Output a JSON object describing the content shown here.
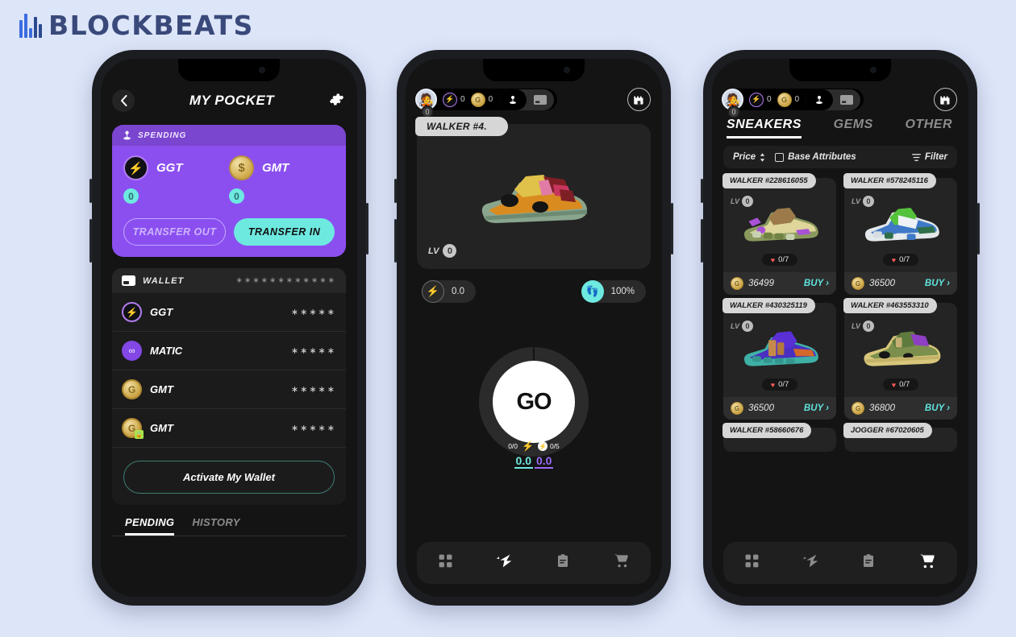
{
  "brand": {
    "name": "BLOCKBEATS"
  },
  "theme": {
    "page_bg": "#dde5f9",
    "screen_bg": "#141414",
    "accent_purple": "#8b4ff0",
    "accent_teal": "#6ee9e0",
    "gold": "#caa446"
  },
  "phone1": {
    "header": {
      "back_icon": "chevron-left-icon",
      "title": "MY POCKET",
      "settings_icon": "gear-icon"
    },
    "spending": {
      "label": "SPENDING",
      "header_icon": "joystick-icon",
      "tokens": [
        {
          "name": "GGT",
          "icon": "ggt-coin-icon",
          "value": "0"
        },
        {
          "name": "GMT",
          "icon": "gmt-coin-icon",
          "value": "0"
        }
      ],
      "transfer_out": "TRANSFER OUT",
      "transfer_in": "TRANSFER IN"
    },
    "wallet": {
      "label": "WALLET",
      "icon": "card-icon",
      "address_mask": "∗∗∗∗∗∗∗∗∗∗∗∗",
      "rows": [
        {
          "name": "GGT",
          "icon": "ggt-coin-icon",
          "amount": "∗∗∗∗∗"
        },
        {
          "name": "MATIC",
          "icon": "matic-coin-icon",
          "amount": "∗∗∗∗∗"
        },
        {
          "name": "GMT",
          "icon": "gmt-coin-icon",
          "amount": "∗∗∗∗∗"
        },
        {
          "name": "GMT",
          "icon": "gmt-locked-coin-icon",
          "amount": "∗∗∗∗∗"
        }
      ],
      "activate_label": "Activate My Wallet"
    },
    "tabs": [
      {
        "label": "PENDING",
        "active": true
      },
      {
        "label": "HISTORY",
        "active": false
      }
    ]
  },
  "phone2": {
    "header": {
      "avatar_icon": "avatar-icon",
      "avatar_badge": "0",
      "currencies": [
        {
          "icon": "ggt-coin-icon",
          "value": "0"
        },
        {
          "icon": "gmt-coin-icon",
          "value": "0"
        }
      ],
      "segments": [
        {
          "icon": "joystick-icon",
          "active": true
        },
        {
          "icon": "card-icon",
          "active": false
        }
      ],
      "right_icon": "castle-icon"
    },
    "sneaker": {
      "name": "WALKER #4.",
      "level_label": "LV",
      "level_value": "0"
    },
    "stats": [
      {
        "icon": "energy-bolt-icon",
        "value": "0.0"
      },
      {
        "icon": "footprint-icon",
        "value": "100%"
      }
    ],
    "go": {
      "label": "GO",
      "left_fraction": "0/0",
      "right_fraction": "0/5",
      "left_value": "0.0",
      "right_value": "0.0",
      "bolt_icon": "bolt-icon"
    },
    "nav": [
      {
        "icon": "grid-icon",
        "active": false
      },
      {
        "icon": "bolt-icon",
        "active": true
      },
      {
        "icon": "clipboard-icon",
        "active": false
      },
      {
        "icon": "cart-icon",
        "active": false
      }
    ]
  },
  "phone3": {
    "header": {
      "avatar_icon": "avatar-icon",
      "avatar_badge": "0",
      "currencies": [
        {
          "icon": "ggt-coin-icon",
          "value": "0"
        },
        {
          "icon": "gmt-coin-icon",
          "value": "0"
        }
      ],
      "segments": [
        {
          "icon": "joystick-icon",
          "active": true
        },
        {
          "icon": "card-icon",
          "active": false
        }
      ],
      "right_icon": "castle-icon"
    },
    "tabs": [
      {
        "label": "SNEAKERS",
        "active": true
      },
      {
        "label": "GEMS",
        "active": false
      },
      {
        "label": "OTHER",
        "active": false
      }
    ],
    "filters": {
      "sort_label": "Price",
      "sort_icon": "sort-updown-icon",
      "checkbox_label": "Base Attributes",
      "checkbox_checked": false,
      "filter_label": "Filter",
      "filter_icon": "filter-icon"
    },
    "cards": [
      {
        "type": "WALKER",
        "id": "#228616055",
        "level_label": "LV",
        "level": "0",
        "hp": "0/7",
        "price": "36499",
        "buy_label": "BUY",
        "palette": [
          "#e2d9a0",
          "#9aa55e",
          "#8a6a40",
          "#b05fd0"
        ]
      },
      {
        "type": "WALKER",
        "id": "#578245116",
        "level_label": "LV",
        "level": "0",
        "hp": "0/7",
        "price": "36500",
        "buy_label": "BUY",
        "palette": [
          "#4a86d6",
          "#57c23c",
          "#e6e9ea",
          "#2e6f4a"
        ]
      },
      {
        "type": "WALKER",
        "id": "#430325119",
        "level_label": "LV",
        "level": "0",
        "hp": "0/7",
        "price": "36500",
        "buy_label": "BUY",
        "palette": [
          "#5b2fd6",
          "#c58a4a",
          "#46b2a8",
          "#d4682a"
        ]
      },
      {
        "type": "WALKER",
        "id": "#463553310",
        "level_label": "LV",
        "level": "0",
        "hp": "0/7",
        "price": "36800",
        "buy_label": "BUY",
        "palette": [
          "#7c8f4c",
          "#8e3fc4",
          "#d8c77a",
          "#5f7a3d"
        ]
      }
    ],
    "cut_cards": [
      {
        "label": "WALKER  #58660676"
      },
      {
        "label": "JOGGER  #67020605"
      }
    ],
    "nav": [
      {
        "icon": "grid-icon",
        "active": false
      },
      {
        "icon": "bolt-icon",
        "active": false
      },
      {
        "icon": "clipboard-icon",
        "active": false
      },
      {
        "icon": "cart-icon",
        "active": true
      }
    ]
  }
}
